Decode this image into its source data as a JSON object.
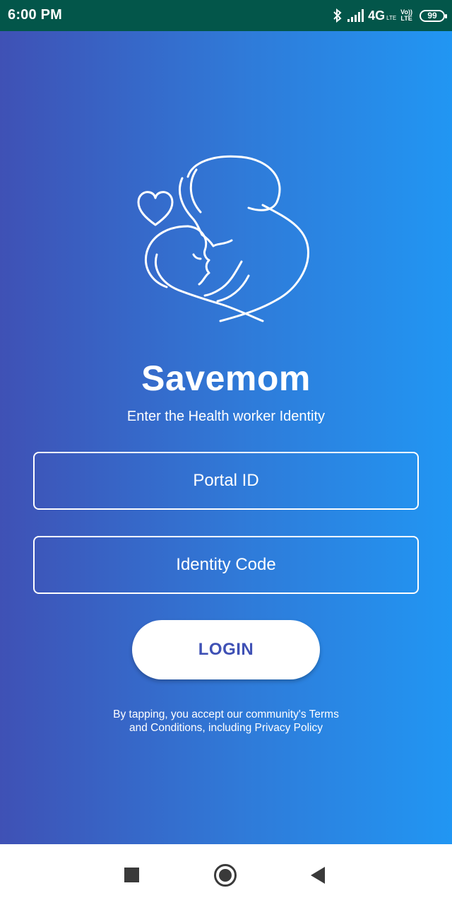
{
  "status_bar": {
    "time": "6:00 PM",
    "network": "4G",
    "network_sub": "LTE",
    "volte_top": "Vo))",
    "volte_bottom": "LTE",
    "battery": "99",
    "icons": [
      "bluetooth-icon",
      "signal-icon",
      "battery-icon"
    ]
  },
  "logo": {
    "icon": "mother-child-heart-logo"
  },
  "brand": {
    "title": "Savemom"
  },
  "subtitle": "Enter the Health worker Identity",
  "form": {
    "portal_id_placeholder": "Portal ID",
    "identity_code_placeholder": "Identity Code",
    "login_label": "LOGIN"
  },
  "terms": {
    "line1": "By tapping, you accept our community's Terms",
    "line2": "and Conditions, including Privacy Policy"
  },
  "nav_bar": {
    "icons": [
      "recents-icon",
      "home-icon",
      "back-icon"
    ]
  },
  "colors": {
    "status_bar": "#03564a",
    "gradient_start": "#3f51b5",
    "gradient_end": "#2196f3",
    "button_text": "#3f51b5"
  }
}
